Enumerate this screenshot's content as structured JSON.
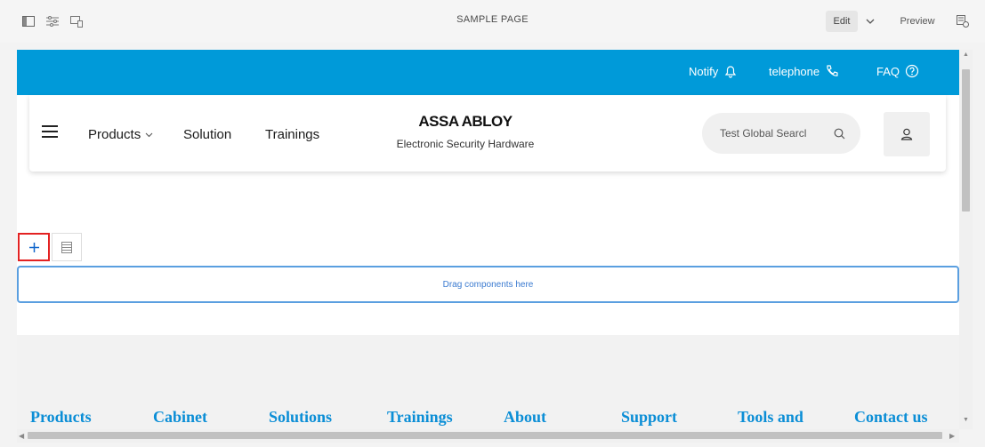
{
  "editor": {
    "title": "SAMPLE PAGE",
    "edit_label": "Edit",
    "preview_label": "Preview",
    "icons": [
      "side-panel-icon",
      "page-properties-icon",
      "emulator-icon",
      "chevron-down-icon",
      "annotations-icon"
    ]
  },
  "utility_bar": {
    "notify_label": "Notify",
    "telephone_label": "telephone",
    "faq_label": "FAQ",
    "bg_color": "#009ad9"
  },
  "header": {
    "nav": [
      "Products",
      "Solution",
      "Trainings"
    ],
    "brand_logo": "ASSA ABLOY",
    "brand_subtitle": "Electronic Security Hardware",
    "search_placeholder": "Test Global Search",
    "search_visible_text": "Test Global Searcl"
  },
  "editing": {
    "dropzone_label": "Drag components here"
  },
  "footer": {
    "links": [
      "Products",
      "Cabinet",
      "Solutions",
      "Trainings",
      "About",
      "Support",
      "Tools and",
      "Contact us"
    ],
    "link_color": "#0b8ed6"
  }
}
